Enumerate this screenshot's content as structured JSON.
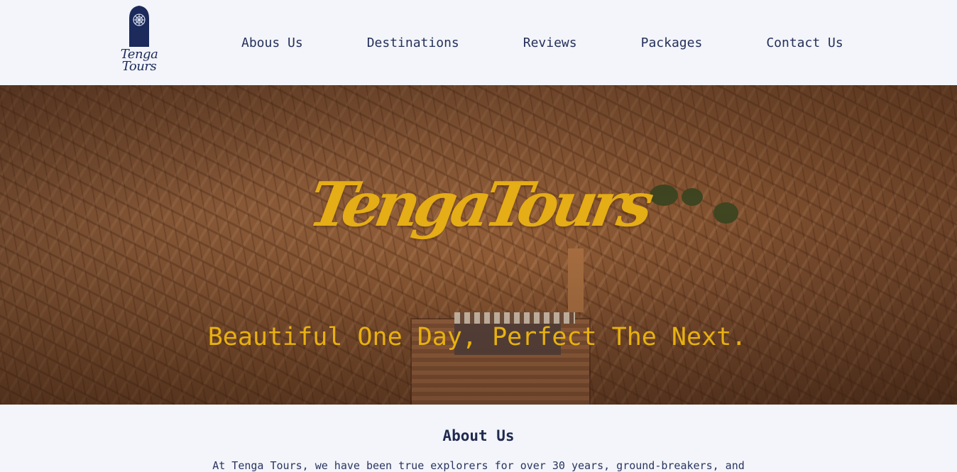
{
  "header": {
    "logo_text": [
      "Tenga",
      "Tours"
    ],
    "nav": [
      {
        "label": "Abous Us"
      },
      {
        "label": "Destinations"
      },
      {
        "label": "Reviews"
      },
      {
        "label": "Packages"
      },
      {
        "label": "Contact Us"
      }
    ]
  },
  "hero": {
    "title": "TengaTours",
    "subtitle": "Beautiful One Day, Perfect The Next."
  },
  "about": {
    "heading": "About Us",
    "text": "At Tenga Tours, we have been true explorers for over 30 years, ground-breakers, and"
  },
  "colors": {
    "accent": "#e5ad16",
    "navy": "#1c2b5c",
    "background": "#f3f5fa"
  }
}
